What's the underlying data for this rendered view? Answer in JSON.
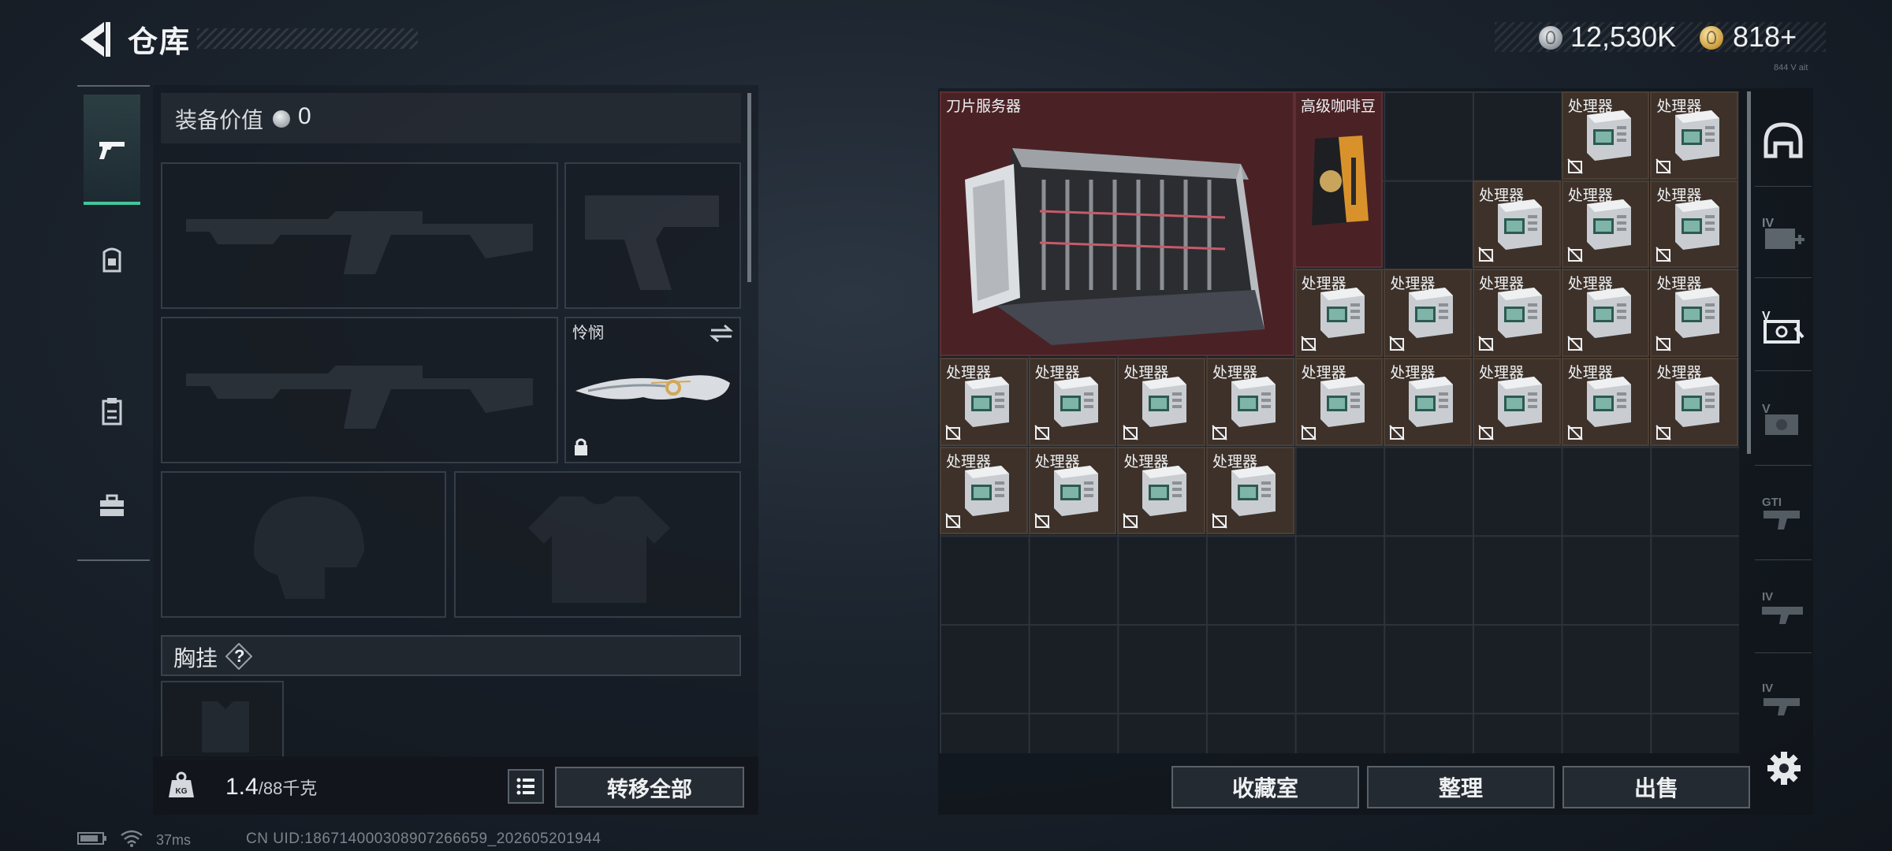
{
  "header": {
    "title": "仓库",
    "silver_amount": "12,530K",
    "gold_amount": "818+",
    "tiny_text": "844 V ait"
  },
  "loadout": {
    "value_label": "装备价值",
    "value_amount": "0",
    "knife_name": "怜悯",
    "chest_label": "胸挂",
    "help_mark": "?",
    "weight_current": "1.4",
    "weight_max": "/88千克",
    "transfer_all": "转移全部"
  },
  "storage": {
    "server_name": "刀片服务器",
    "coffee_name": "高级咖啡豆",
    "processor_name": "处理器"
  },
  "actions": {
    "collection": "收藏室",
    "organize": "整理",
    "sell": "出售"
  },
  "status": {
    "ping": "37ms",
    "uid": "CN UID:18671400030890726665​9_202605201944"
  },
  "colors": {
    "accent_green": "#43c59b",
    "valuable_red": "#4a2226",
    "item_brown": "#3d3129"
  }
}
